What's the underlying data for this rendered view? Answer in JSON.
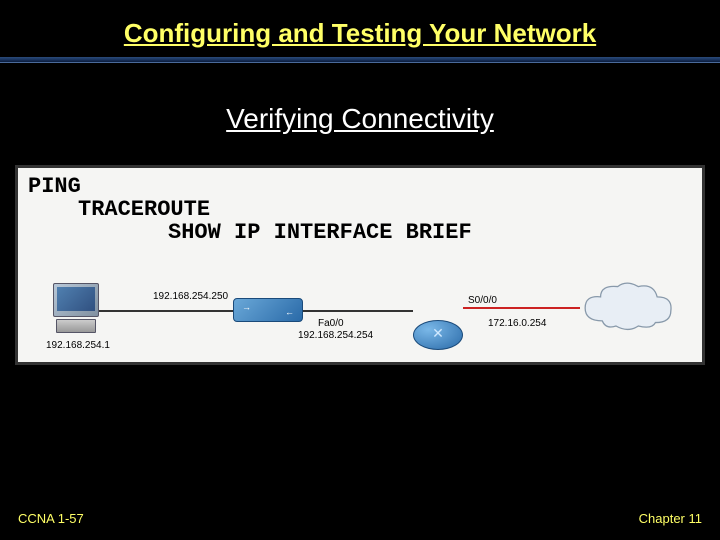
{
  "header": {
    "title": "Configuring and Testing Your Network"
  },
  "content": {
    "subtitle": "Verifying Connectivity"
  },
  "commands": {
    "cmd1": "PING",
    "cmd2": "TRACEROUTE",
    "cmd3": "SHOW IP INTERFACE BRIEF"
  },
  "labels": {
    "pc_ip": "192.168.254.1",
    "switch_ip_top": "192.168.254.250",
    "switch_if": "Fa0/0",
    "switch_ip_bottom": "192.168.254.254",
    "router_serial": "S0/0/0",
    "router_wan_ip": "172.16.0.254"
  },
  "footer": {
    "left": "CCNA 1-57",
    "right": "Chapter 11"
  }
}
